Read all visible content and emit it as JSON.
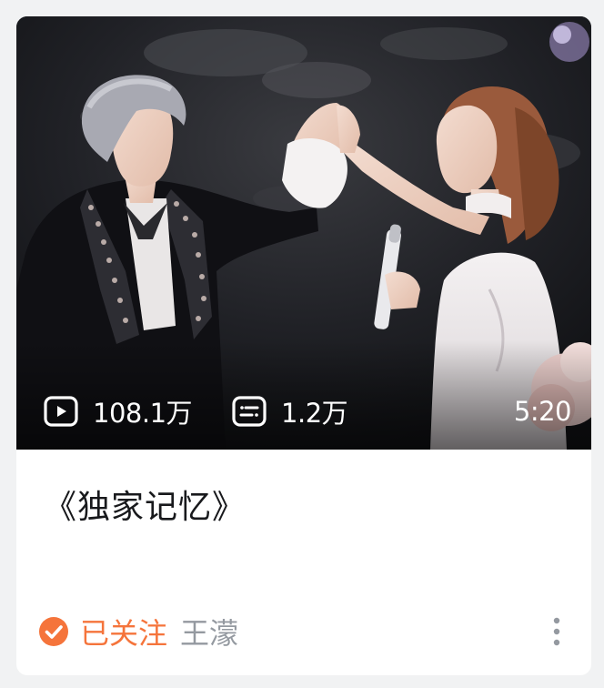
{
  "video": {
    "views": "108.1万",
    "danmaku": "1.2万",
    "duration": "5:20",
    "title": "《独家记忆》"
  },
  "uploader": {
    "follow_label": "已关注",
    "name": "王濛"
  },
  "icons": {
    "views": "play-count-icon",
    "danmaku": "danmaku-icon",
    "follow": "followed-check-icon",
    "more": "more-vertical-icon"
  },
  "colors": {
    "accent": "#f5743b",
    "author": "#9499a0",
    "title": "#18191c",
    "background": "#f1f2f3"
  }
}
